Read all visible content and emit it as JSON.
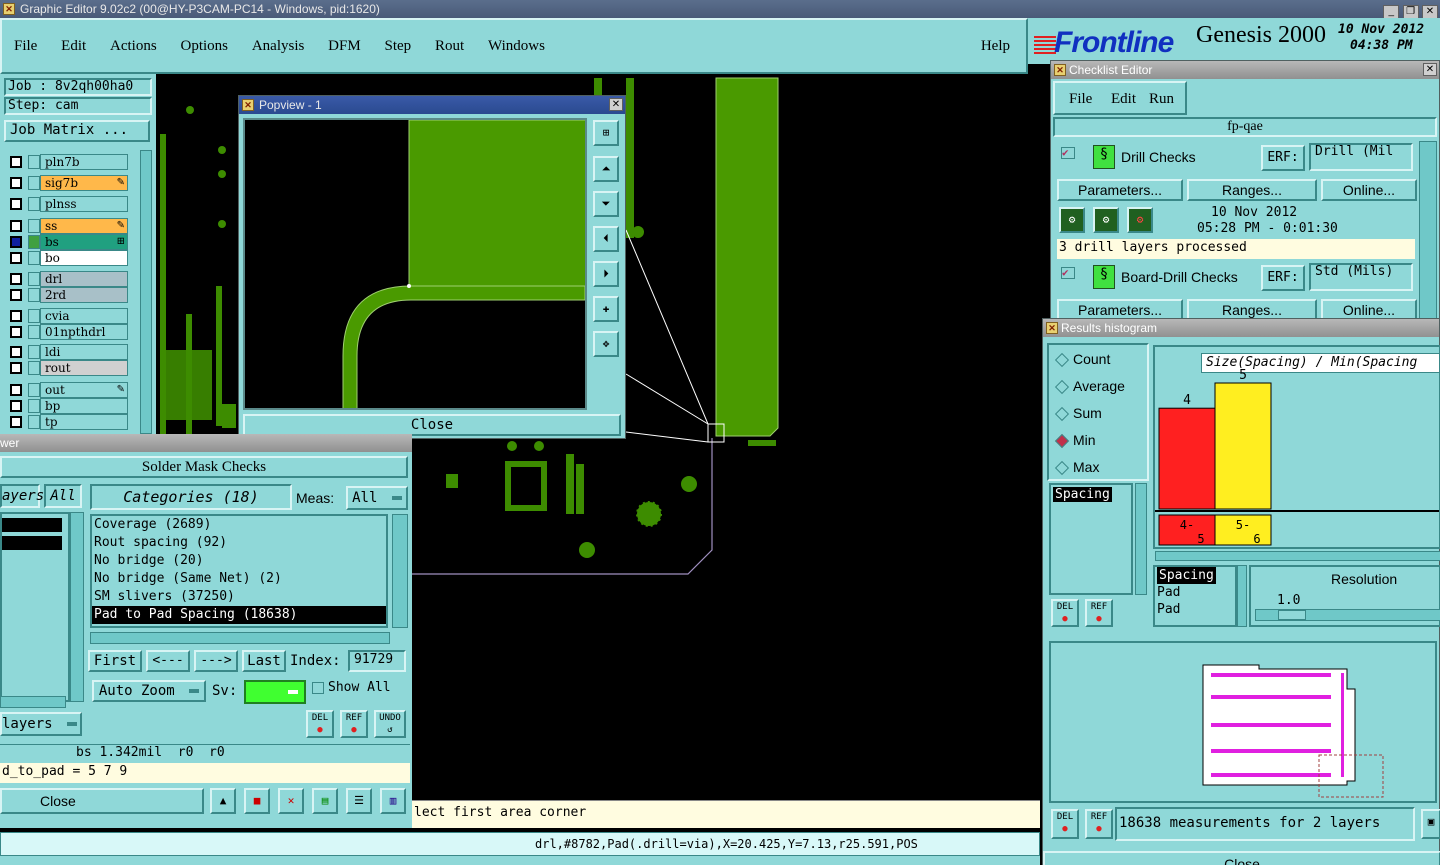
{
  "window": {
    "title": "Graphic Editor 9.02c2 (00@HY-P3CAM-PC14 - Windows, pid:1620)"
  },
  "menu": {
    "items": [
      "File",
      "Edit",
      "Actions",
      "Options",
      "Analysis",
      "DFM",
      "Step",
      "Rout",
      "Windows"
    ],
    "help": "Help"
  },
  "brand": {
    "logo": "Frontline",
    "product": "Genesis 2000",
    "date": "10 Nov 2012",
    "time": "04:38 PM"
  },
  "job": {
    "job_label": "Job : 8v2qh00ha0",
    "step_label": "Step: cam",
    "matrix_button": "Job Matrix ..."
  },
  "layers": [
    {
      "name": "pln7b",
      "color": "#8fd8d8"
    },
    {
      "name": "sig7b",
      "color": "#ffb84a",
      "flag": "✎"
    },
    {
      "name": "plnss",
      "color": "#8fd8d8"
    },
    {
      "name": "ss",
      "color": "#ffb84a",
      "flag": "✎"
    },
    {
      "name": "bs",
      "color": "#20a080",
      "flag": "⊞"
    },
    {
      "name": "bo",
      "color": "#ffffff"
    },
    {
      "name": "drl",
      "color": "#a8c0c8"
    },
    {
      "name": "2rd",
      "color": "#a8c0c8"
    },
    {
      "name": "cvia",
      "color": "#8fd8d8"
    },
    {
      "name": "01npthdrl",
      "color": "#8fd8d8"
    },
    {
      "name": "ldi",
      "color": "#8fd8d8"
    },
    {
      "name": "rout",
      "color": "#d0d0d0"
    },
    {
      "name": "out",
      "color": "#8fd8d8",
      "flag": "✎"
    },
    {
      "name": "bp",
      "color": "#8fd8d8"
    },
    {
      "name": "tp",
      "color": "#8fd8d8"
    }
  ],
  "popview": {
    "title": "Popview - 1",
    "close": "Close"
  },
  "viewer": {
    "title_fragment": "wer",
    "heading": "Solder Mask Checks",
    "layers_label": "ayers",
    "all_label": "All",
    "categories_label": "Categories (18)",
    "meas_label": "Meas:",
    "meas_value": "All",
    "categories": [
      "Coverage (2689)",
      "Rout spacing (92)",
      "No bridge (20)",
      "No bridge (Same Net) (2)",
      "SM slivers (37250)",
      "Pad to Pad Spacing (18638)"
    ],
    "selected_index": 5,
    "nav": {
      "first": "First",
      "prev": "<---",
      "next": "--->",
      "last": "Last",
      "index_label": "Index:",
      "index_value": "91729"
    },
    "auto_zoom": "Auto Zoom",
    "sv_label": "Sv:",
    "show_all": "Show All",
    "layers_dropdown": "layers",
    "status1": "bs 1.342mil  r0  r0",
    "status2": "d_to_pad = 5 7 9",
    "close": "Close",
    "del": "DEL",
    "ref": "REF",
    "undo": "UNDO"
  },
  "prompt": {
    "text": "lect first area corner"
  },
  "statusbar": {
    "text": "drl,#8782,Pad(.drill=via),X=20.425,Y=7.13,r25.591,POS"
  },
  "checklist": {
    "title": "Checklist Editor",
    "menu": [
      "File",
      "Edit",
      "Run"
    ],
    "name": "fp-qae",
    "checks": [
      {
        "name": "Drill Checks",
        "erf_label": "ERF:",
        "erf_value": "Drill (Mil"
      },
      {
        "name": "Board-Drill Checks",
        "erf_label": "ERF:",
        "erf_value": "Std (Mils)"
      }
    ],
    "params": "Parameters...",
    "ranges": "Ranges...",
    "online": "Online...",
    "date": "10 Nov 2012",
    "time": "05:28 PM - 0:01:30",
    "message": "3 drill layers processed"
  },
  "histogram": {
    "title": "Results histogram",
    "modes": [
      "Count",
      "Average",
      "Sum",
      "Min",
      "Max"
    ],
    "selected_mode": "Min",
    "list_item": "Spacing",
    "chart_title": "Size(Spacing) / Min(Spacing",
    "resolution_label": "Resolution",
    "resolution_value": "1.0",
    "list2": [
      "Spacing",
      "Pad",
      "Pad"
    ],
    "summary": "18638 measurements for 2 layers",
    "close": "Close",
    "del": "DEL",
    "ref": "REF"
  },
  "chart_data": {
    "type": "bar",
    "title": "Size(Spacing) / Min(Spacing",
    "categories": [
      "4-5",
      "5-6"
    ],
    "values": [
      4,
      5
    ],
    "colors": [
      "#ff2020",
      "#ffee20"
    ]
  }
}
